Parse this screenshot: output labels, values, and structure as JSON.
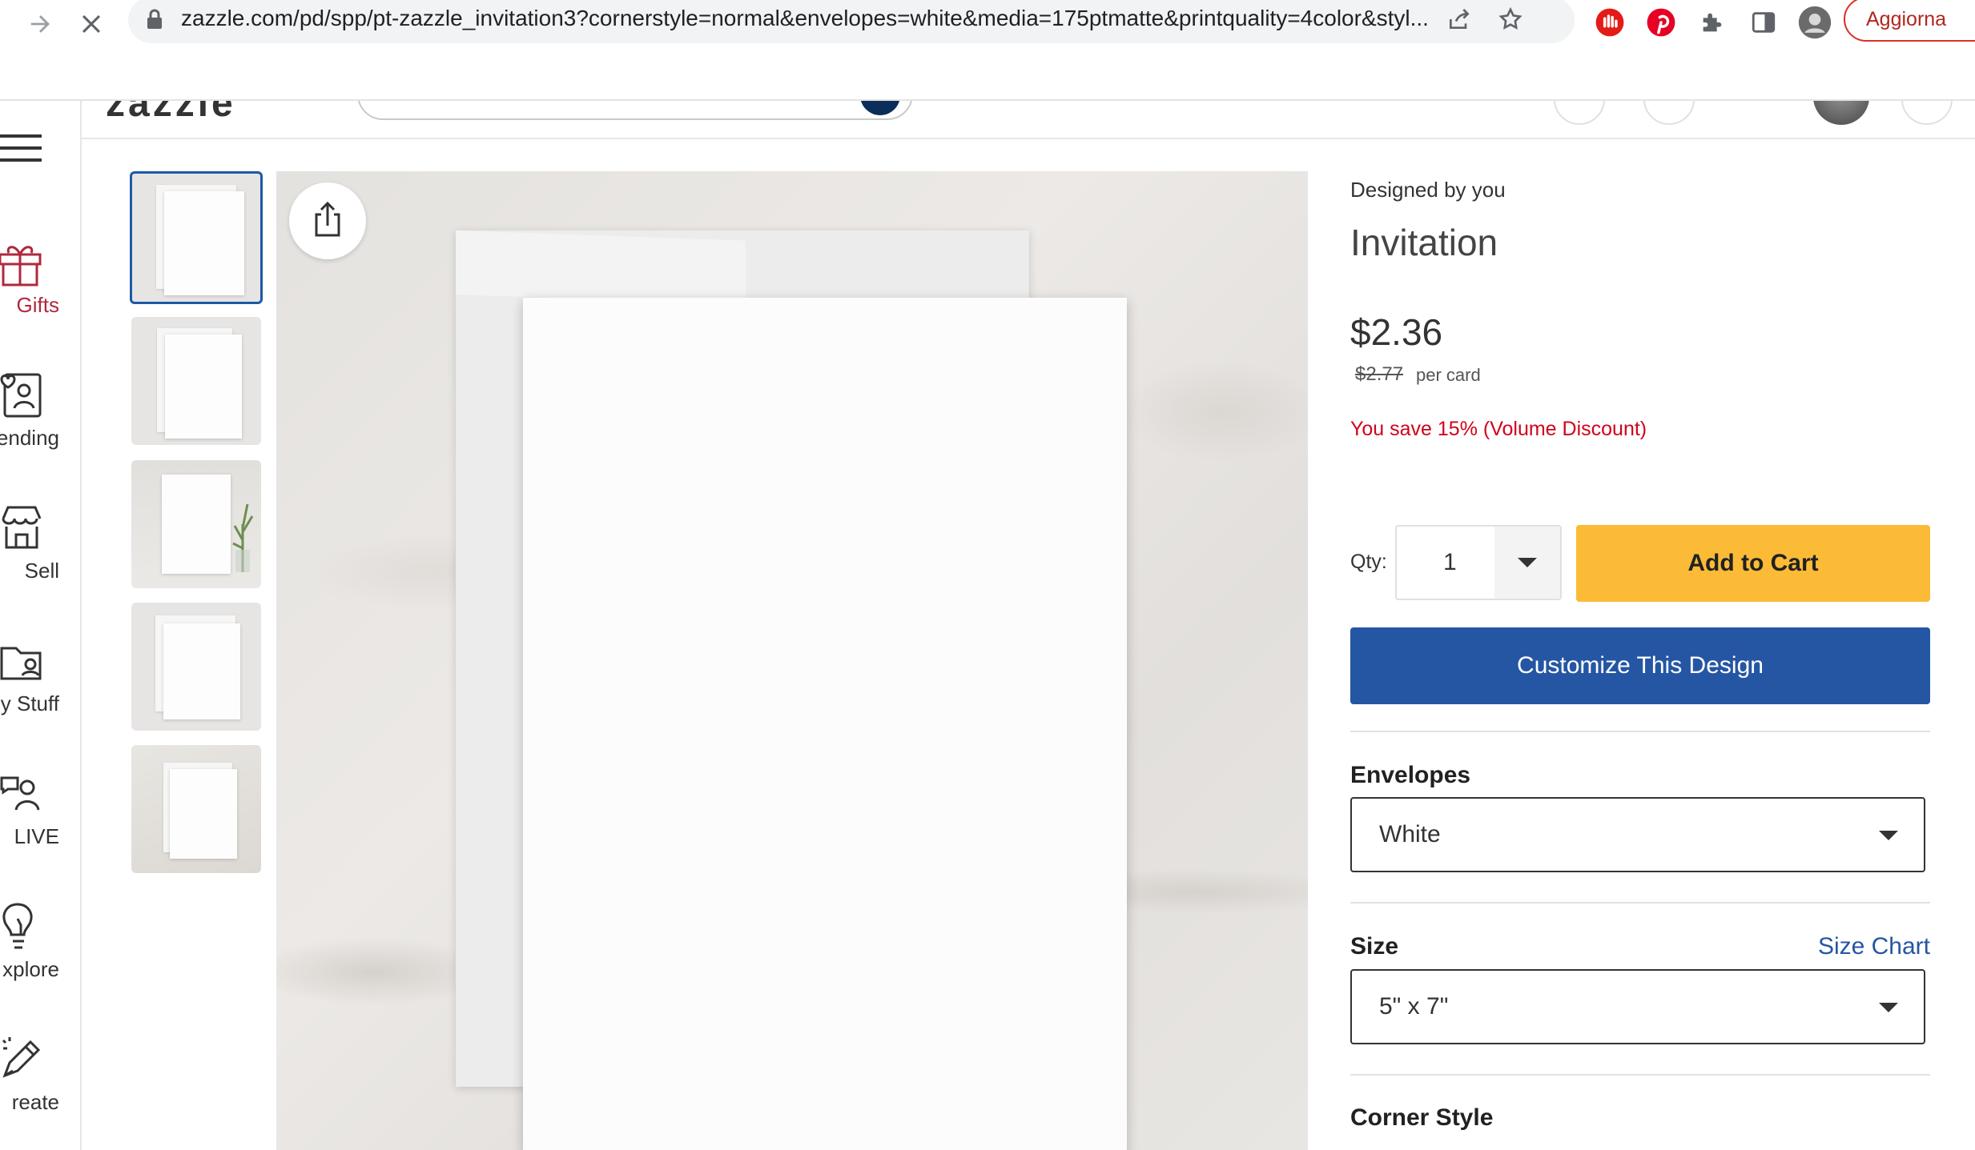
{
  "browser": {
    "url": "zazzle.com/pd/spp/pt-zazzle_invitation3?cornerstyle=normal&envelopes=white&media=175ptmatte&printquality=4color&styl...",
    "update_label": "Aggiorna"
  },
  "rail": {
    "items": [
      {
        "label": "Gifts",
        "icon": "gift-icon"
      },
      {
        "label": "ending",
        "icon": "heart-person-icon"
      },
      {
        "label": "Sell",
        "icon": "storefront-icon"
      },
      {
        "label": "y Stuff",
        "icon": "folder-icon"
      },
      {
        "label": "LIVE",
        "icon": "person-live-icon"
      },
      {
        "label": "xplore",
        "icon": "lightbulb-icon"
      },
      {
        "label": "reate",
        "icon": "magic-pencil-icon"
      }
    ],
    "accent_color": "#b0283c"
  },
  "product": {
    "designed_by": "Designed by you",
    "title": "Invitation",
    "price": "$2.36",
    "old_price": "$2.77",
    "per_unit": "per card",
    "savings": "You save 15% (Volume Discount)",
    "qty_label": "Qty:",
    "qty_value": "1",
    "add_to_cart": "Add to Cart",
    "customize": "Customize This Design",
    "envelopes_label": "Envelopes",
    "envelopes_value": "White",
    "size_label": "Size",
    "size_chart": "Size Chart",
    "size_value": "5\" x 7\"",
    "corner_style_label": "Corner Style"
  },
  "colors": {
    "add_to_cart_bg": "#fbbb36",
    "customize_bg": "#2556a3",
    "savings_text": "#d0021b",
    "thumb_active_border": "#1d5aa6"
  }
}
